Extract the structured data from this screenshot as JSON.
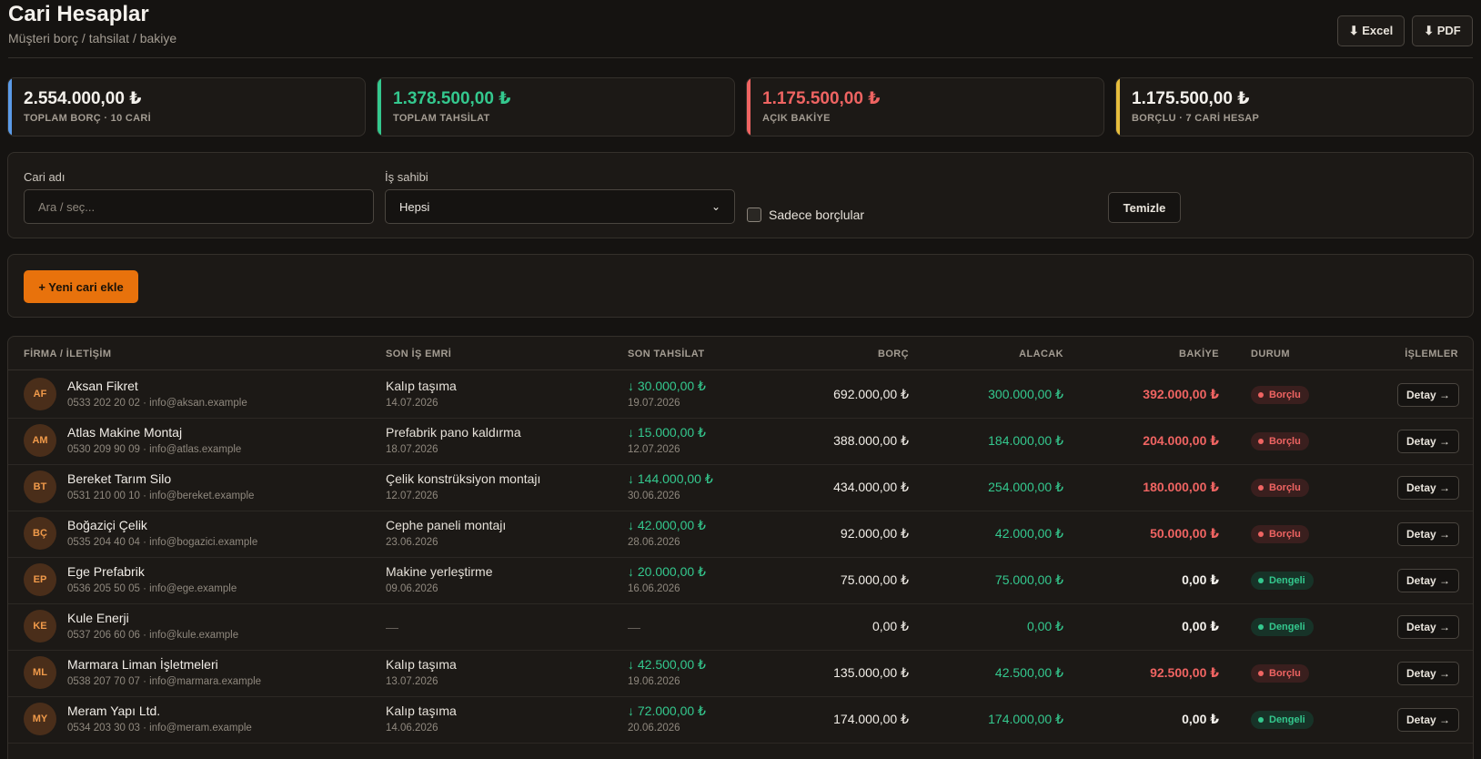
{
  "header": {
    "title": "Cari Hesaplar",
    "subtitle": "Müşteri borç / tahsilat / bakiye",
    "excel_label": "⬇ Excel",
    "pdf_label": "⬇ PDF"
  },
  "stats": [
    {
      "value": "2.554.000,00 ₺",
      "label": "TOPLAM BORÇ · 10 CARİ",
      "color": "#f4f1ec"
    },
    {
      "value": "1.378.500,00 ₺",
      "label": "TOPLAM TAHSİLAT",
      "color": "#34c88e"
    },
    {
      "value": "1.175.500,00 ₺",
      "label": "AÇIK BAKİYE",
      "color": "#ef6462"
    },
    {
      "value": "1.175.500,00 ₺",
      "label": "BORÇLU · 7 CARİ HESAP",
      "color": "#f4f1ec"
    }
  ],
  "filters": {
    "cari_label": "Cari adı",
    "cari_placeholder": "Ara / seç...",
    "owner_label": "İş sahibi",
    "owner_value": "Hepsi",
    "only_debtors_label": "Sadece borçlular",
    "clear_label": "Temizle"
  },
  "actions": {
    "add_label": "+ Yeni cari ekle"
  },
  "table": {
    "columns": {
      "firma": "FİRMA / İLETİŞİM",
      "son_is": "SON İŞ EMRİ",
      "son_tahsilat": "SON TAHSİLAT",
      "borc": "BORÇ",
      "alacak": "ALACAK",
      "bakiye": "BAKİYE",
      "durum": "DURUM",
      "islemler": "İŞLEMLER"
    },
    "detail_label": "Detay →",
    "rows": [
      {
        "initials": "AF",
        "name": "Aksan Fikret",
        "contact": "0533 202 20 02 · info@aksan.example",
        "job": "Kalıp taşıma",
        "job_date": "14.07.2026",
        "pay": "↓ 30.000,00 ₺",
        "pay_date": "19.07.2026",
        "borc": "692.000,00 ₺",
        "alacak": "300.000,00 ₺",
        "bakiye": "392.000,00 ₺",
        "status": "Borçlu"
      },
      {
        "initials": "AM",
        "name": "Atlas Makine Montaj",
        "contact": "0530 209 90 09 · info@atlas.example",
        "job": "Prefabrik pano kaldırma",
        "job_date": "18.07.2026",
        "pay": "↓ 15.000,00 ₺",
        "pay_date": "12.07.2026",
        "borc": "388.000,00 ₺",
        "alacak": "184.000,00 ₺",
        "bakiye": "204.000,00 ₺",
        "status": "Borçlu"
      },
      {
        "initials": "BT",
        "name": "Bereket Tarım Silo",
        "contact": "0531 210 00 10 · info@bereket.example",
        "job": "Çelik konstrüksiyon montajı",
        "job_date": "12.07.2026",
        "pay": "↓ 144.000,00 ₺",
        "pay_date": "30.06.2026",
        "borc": "434.000,00 ₺",
        "alacak": "254.000,00 ₺",
        "bakiye": "180.000,00 ₺",
        "status": "Borçlu"
      },
      {
        "initials": "BÇ",
        "name": "Boğaziçi Çelik",
        "contact": "0535 204 40 04 · info@bogazici.example",
        "job": "Cephe paneli montajı",
        "job_date": "23.06.2026",
        "pay": "↓ 42.000,00 ₺",
        "pay_date": "28.06.2026",
        "borc": "92.000,00 ₺",
        "alacak": "42.000,00 ₺",
        "bakiye": "50.000,00 ₺",
        "status": "Borçlu"
      },
      {
        "initials": "EP",
        "name": "Ege Prefabrik",
        "contact": "0536 205 50 05 · info@ege.example",
        "job": "Makine yerleştirme",
        "job_date": "09.06.2026",
        "pay": "↓ 20.000,00 ₺",
        "pay_date": "16.06.2026",
        "borc": "75.000,00 ₺",
        "alacak": "75.000,00 ₺",
        "bakiye": "0,00 ₺",
        "status": "Dengeli"
      },
      {
        "initials": "KE",
        "name": "Kule Enerji",
        "contact": "0537 206 60 06 · info@kule.example",
        "job": "—",
        "job_date": "",
        "pay": "—",
        "pay_date": "",
        "borc": "0,00 ₺",
        "alacak": "0,00 ₺",
        "bakiye": "0,00 ₺",
        "status": "Dengeli"
      },
      {
        "initials": "ML",
        "name": "Marmara Liman İşletmeleri",
        "contact": "0538 207 70 07 · info@marmara.example",
        "job": "Kalıp taşıma",
        "job_date": "13.07.2026",
        "pay": "↓ 42.500,00 ₺",
        "pay_date": "19.06.2026",
        "borc": "135.000,00 ₺",
        "alacak": "42.500,00 ₺",
        "bakiye": "92.500,00 ₺",
        "status": "Borçlu"
      },
      {
        "initials": "MY",
        "name": "Meram Yapı Ltd.",
        "contact": "0534 203 30 03 · info@meram.example",
        "job": "Kalıp taşıma",
        "job_date": "14.06.2026",
        "pay": "↓ 72.000,00 ₺",
        "pay_date": "20.06.2026",
        "borc": "174.000,00 ₺",
        "alacak": "174.000,00 ₺",
        "bakiye": "0,00 ₺",
        "status": "Dengeli"
      }
    ]
  }
}
